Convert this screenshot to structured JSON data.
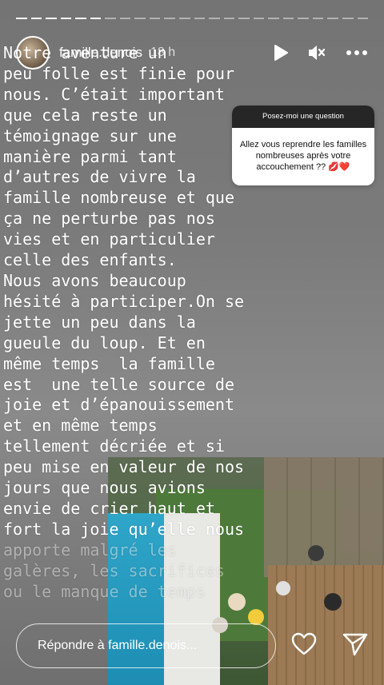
{
  "progress": {
    "segments": 24,
    "completed": 6
  },
  "header": {
    "username": "famille.denois",
    "time": "18 h",
    "icons": [
      "play-icon",
      "mute-icon",
      "more-icon"
    ]
  },
  "story": {
    "lines": [
      "Notre aventure un",
      "peu folle est finie pour",
      "nous. C’était important",
      "que cela reste un",
      "témoignage sur une",
      "manière parmi tant",
      "d’autres de vivre la",
      "famille nombreuse et que",
      "ça ne perturbe pas nos",
      "vies et en particulier",
      "celle des enfants.",
      "Nous avons beaucoup",
      "hésité à participer.On se",
      "jette un peu dans la",
      "gueule du loup. Et en",
      "même temps  la famille",
      "est  une telle source de",
      "joie et d’épanouissement",
      "et en même temps",
      "tellement décriée et si",
      "peu mise en valeur de nos",
      "jours que nous avions",
      "envie de crier haut et",
      "fort la joie qu’elle nous",
      "apporte malgré les",
      "galères, les sacrifices",
      "ou le manque de temps"
    ]
  },
  "sticker": {
    "header": "Posez-moi une question",
    "question": "Allez  vous reprendre les familles nombreuses après votre accouchement ?? 💋❤️"
  },
  "footer": {
    "reply_placeholder": "Répondre à famille.denois...",
    "icons": [
      "heart-icon",
      "send-icon"
    ]
  }
}
